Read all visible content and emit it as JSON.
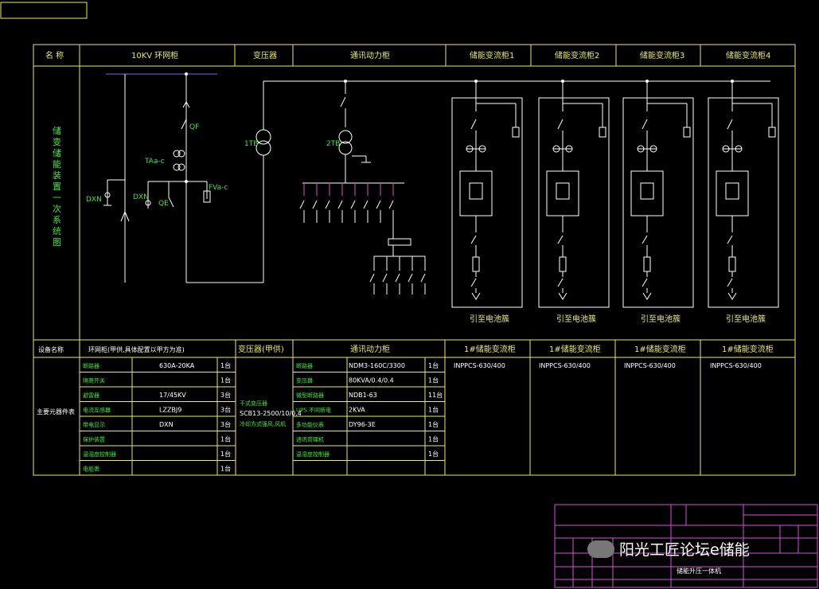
{
  "header": {
    "name_label": "名 称",
    "ring_cabinet": "10KV 环网柜",
    "transformer": "变压器",
    "power_cabinet": "通讯动力柜",
    "pcs1": "储能变流柜1",
    "pcs2": "储能变流柜2",
    "pcs3": "储能变流柜3",
    "pcs4": "储能变流柜4"
  },
  "side_title": "储变储能装置一次系统图",
  "diagram_labels": {
    "dxn1": "DXN",
    "dxn2": "DXN",
    "qe": "QE",
    "qf": "QF",
    "ta": "TAa-c",
    "fv": "FVa-c",
    "t1": "1TB",
    "t2": "2TB",
    "battery": "引至电池簇"
  },
  "table_header": {
    "device_name": "设备名称",
    "ring_note": "环网柜(甲供,具体配置以甲方为准)",
    "transformer": "变压器(甲供)",
    "power_cabinet": "通讯动力柜",
    "pcs1": "1#储能变流柜",
    "pcs2": "1#储能变流柜",
    "pcs3": "1#储能变流柜",
    "pcs4": "1#储能变流柜"
  },
  "side_label": "主要元器件表",
  "ring_rows": [
    {
      "name": "断路器",
      "spec": "630A-20KA",
      "qty": "1台"
    },
    {
      "name": "隔离开关",
      "spec": "",
      "qty": "1台"
    },
    {
      "name": "避雷器",
      "spec": "17/45KV",
      "qty": "3台"
    },
    {
      "name": "电流互感器",
      "spec": "LZZBJ9",
      "qty": "3台"
    },
    {
      "name": "带电显示",
      "spec": "DXN",
      "qty": "3台"
    },
    {
      "name": "保护装置",
      "spec": "",
      "qty": "1台"
    },
    {
      "name": "温湿度控制器",
      "spec": "",
      "qty": "1台"
    },
    {
      "name": "电能表",
      "spec": "",
      "qty": "1台"
    }
  ],
  "transformer_spec": [
    "干式变压器",
    "SCB13-2500/10/0.4",
    "冷却方式强风,风机"
  ],
  "power_rows": [
    {
      "name": "断路器",
      "spec": "NDM3-160C/3300",
      "qty": "1台"
    },
    {
      "name": "变压器",
      "spec": "80KVA/0.4/0.4",
      "qty": "1台"
    },
    {
      "name": "微型断路器",
      "spec": "NDB1-63",
      "qty": "11台"
    },
    {
      "name": "UPS 不间断电",
      "spec": "2KVA",
      "qty": "1台"
    },
    {
      "name": "多功能仪表",
      "spec": "DY96-3E",
      "qty": "1台"
    },
    {
      "name": "通讯管理机",
      "spec": "",
      "qty": "1台"
    },
    {
      "name": "温湿度控制器",
      "spec": "",
      "qty": "1台"
    }
  ],
  "pcs_model": "INPPCS-630/400",
  "title_block": {
    "project": "储能升压一体机"
  },
  "watermark": "阳光工匠论坛e储能",
  "colors": {
    "frame": "#e8e86a",
    "wire": "#ffffff",
    "text": "#3ce63c",
    "title_block": "#d94fd9"
  }
}
